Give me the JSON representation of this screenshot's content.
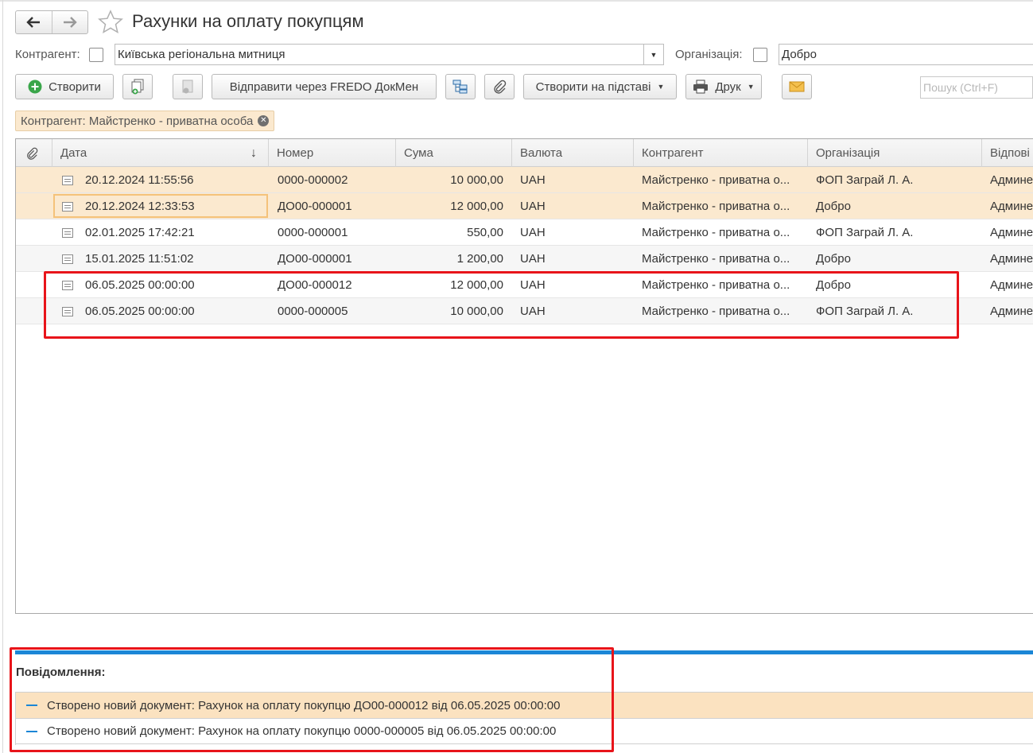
{
  "window": {
    "title": "Рахунки на оплату покупцям"
  },
  "filters": {
    "counterparty_label": "Контрагент:",
    "counterparty_value": "Київська регіональна митниця",
    "organization_label": "Організація:",
    "organization_value": "Добро"
  },
  "toolbar": {
    "create_label": "Створити",
    "send_label": "Відправити через FREDO ДокМен",
    "create_based_label": "Створити на підставі",
    "print_label": "Друк",
    "search_placeholder": "Пошук (Ctrl+F)"
  },
  "active_filter": {
    "text": "Контрагент: Майстренко - приватна особа"
  },
  "table": {
    "columns": [
      "Дата",
      "Номер",
      "Сума",
      "Валюта",
      "Контрагент",
      "Організація",
      "Відпові"
    ],
    "rows": [
      {
        "date": "20.12.2024 11:55:56",
        "number": "0000-000002",
        "sum": "10 000,00",
        "currency": "UAH",
        "counterparty": "Майстренко - приватна о...",
        "organization": "ФОП Заграй Л. А.",
        "responsible": "Админе"
      },
      {
        "date": "20.12.2024 12:33:53",
        "number": "ДО00-000001",
        "sum": "12 000,00",
        "currency": "UAH",
        "counterparty": "Майстренко - приватна о...",
        "organization": "Добро",
        "responsible": "Админе"
      },
      {
        "date": "02.01.2025 17:42:21",
        "number": "0000-000001",
        "sum": "550,00",
        "currency": "UAH",
        "counterparty": "Майстренко - приватна о...",
        "organization": "ФОП Заграй Л. А.",
        "responsible": "Админе"
      },
      {
        "date": "15.01.2025 11:51:02",
        "number": "ДО00-000001",
        "sum": "1 200,00",
        "currency": "UAH",
        "counterparty": "Майстренко - приватна о...",
        "organization": "Добро",
        "responsible": "Админе"
      },
      {
        "date": "06.05.2025 00:00:00",
        "number": "ДО00-000012",
        "sum": "12 000,00",
        "currency": "UAH",
        "counterparty": "Майстренко - приватна о...",
        "organization": "Добро",
        "responsible": "Админе"
      },
      {
        "date": "06.05.2025 00:00:00",
        "number": "0000-000005",
        "sum": "10 000,00",
        "currency": "UAH",
        "counterparty": "Майстренко - приватна о...",
        "organization": "ФОП Заграй Л. А.",
        "responsible": "Админе"
      }
    ]
  },
  "messages": {
    "title": "Повідомлення:",
    "items": [
      "Створено новий документ: Рахунок на оплату покупцю ДО00-000012 від 06.05.2025 00:00:00",
      "Створено новий документ: Рахунок на оплату покупцю 0000-000005 від 06.05.2025 00:00:00"
    ]
  },
  "colors": {
    "highlight": "#fbe9cf",
    "accent_blue": "#1b86d6",
    "annotation_red": "#e8141a",
    "create_green": "#3aa64a"
  }
}
